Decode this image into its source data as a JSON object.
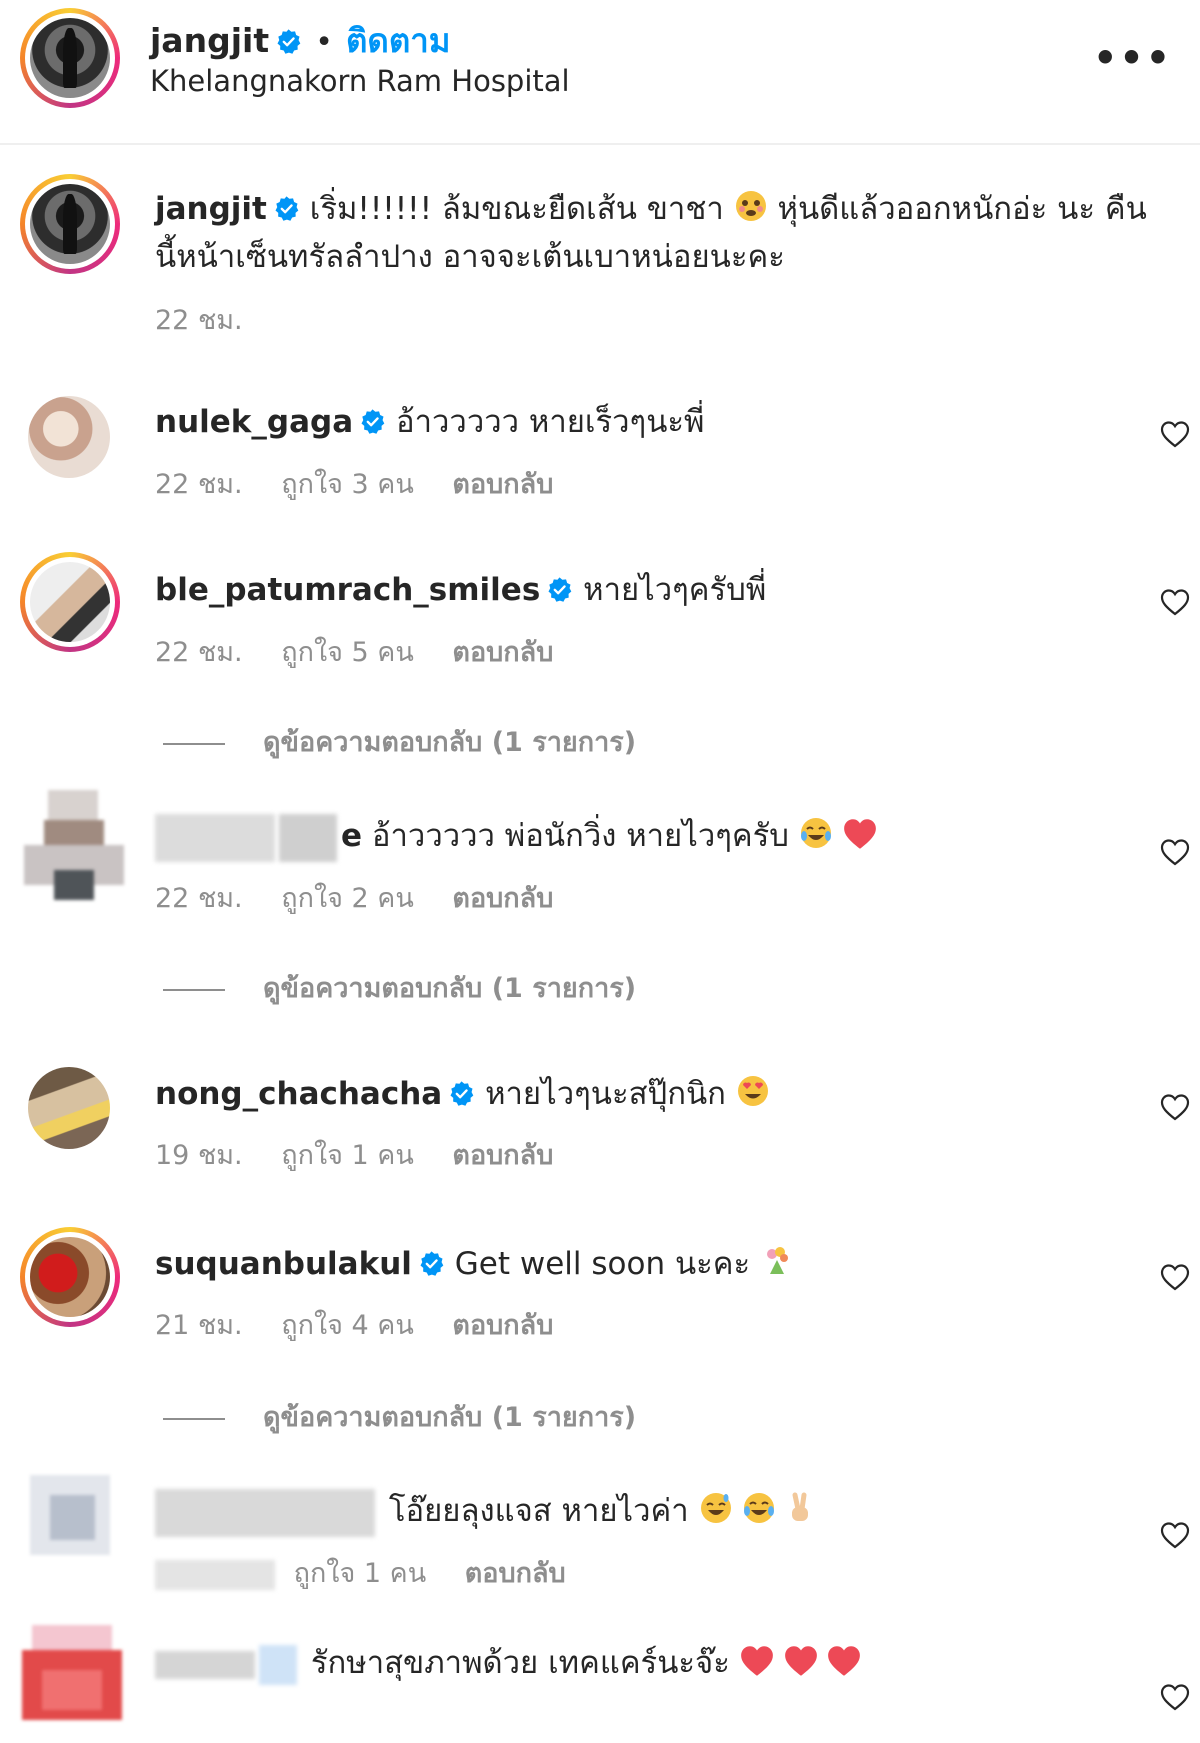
{
  "header": {
    "username": "jangjit",
    "separator": "•",
    "follow_label": "ติดตาม",
    "location": "Khelangnakorn Ram Hospital",
    "more_label": "•••"
  },
  "caption": {
    "username": "jangjit",
    "text_line1": "เริ่ม!!!!!! ล้มขณะยืดเส้น ขาชา",
    "text_line1b": "หุ่นดีแล้วออกหนักอ่ะ นะ คืน",
    "text_line2": "นี้หน้าเซ็นทรัลลำปาง อาจจะเต้นเบาหน่อยนะคะ",
    "time": "22 ชม."
  },
  "comments": [
    {
      "username": "nulek_gaga",
      "text": "อ้าววววว หายเร็วๆนะพี่",
      "time": "22 ชม.",
      "likes": "ถูกใจ 3 คน",
      "reply": "ตอบกลับ"
    },
    {
      "username": "ble_patumrach_smiles",
      "text": "หายไวๆครับพี่",
      "time": "22 ชม.",
      "likes": "ถูกใจ 5 คน",
      "reply": "ตอบกลับ",
      "view_replies": "ดูข้อความตอบกลับ (1 รายการ)"
    },
    {
      "username_suffix": "e",
      "text": "อ้าววววว พ่อนักวิ่ง หายไวๆครับ",
      "time": "22 ชม.",
      "likes": "ถูกใจ 2 คน",
      "reply": "ตอบกลับ",
      "view_replies": "ดูข้อความตอบกลับ (1 รายการ)"
    },
    {
      "username": "nong_chachacha",
      "text": "หายไวๆนะสปุ๊กนิก",
      "time": "19 ชม.",
      "likes": "ถูกใจ 1 คน",
      "reply": "ตอบกลับ"
    },
    {
      "username": "suquanbulakul",
      "text": "Get well soon นะคะ",
      "time": "21 ชม.",
      "likes": "ถูกใจ 4 คน",
      "reply": "ตอบกลับ",
      "view_replies": "ดูข้อความตอบกลับ (1 รายการ)"
    },
    {
      "text": "โอ๊ยยลุงแจส หายไวค่า",
      "likes": "ถูกใจ 1 คน",
      "reply": "ตอบกลับ"
    },
    {
      "text": "รักษาสุขภาพด้วย เทคแคร์นะจ๊ะ"
    }
  ],
  "icons": {
    "verified": "verified-badge-icon",
    "heart": "heart-outline-icon",
    "more": "more-horizontal-icon"
  },
  "colors": {
    "accent": "#0095f6",
    "secondary_text": "#8e8e8e",
    "verified": "#0095f6",
    "heart_emoji": "#ed4956"
  }
}
